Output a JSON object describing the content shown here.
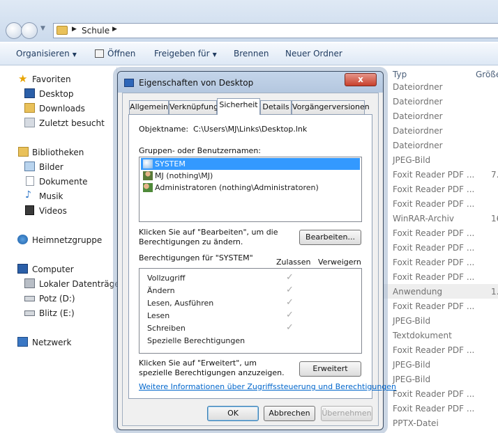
{
  "explorer": {
    "address": {
      "segment": "Schule"
    },
    "toolbar": {
      "organize": "Organisieren",
      "open": "Öffnen",
      "share": "Freigeben für",
      "burn": "Brennen",
      "new_folder": "Neuer Ordner"
    },
    "nav": {
      "favorites": "Favoriten",
      "desktop": "Desktop",
      "downloads": "Downloads",
      "recent": "Zuletzt besucht",
      "libraries": "Bibliotheken",
      "pictures": "Bilder",
      "documents": "Dokumente",
      "music": "Musik",
      "videos": "Videos",
      "homegroup": "Heimnetzgruppe",
      "computer": "Computer",
      "local_disk": "Lokaler Datenträger",
      "potz": "Potz (D:)",
      "blitz": "Blitz (E:)",
      "network": "Netzwerk"
    },
    "columns": {
      "type": "Typ",
      "size": "Größe"
    },
    "files": [
      {
        "type": "Dateiordner",
        "size": ""
      },
      {
        "type": "Dateiordner",
        "size": ""
      },
      {
        "type": "Dateiordner",
        "size": ""
      },
      {
        "type": "Dateiordner",
        "size": ""
      },
      {
        "type": "Dateiordner",
        "size": ""
      },
      {
        "type": "JPEG-Bild",
        "size": ""
      },
      {
        "type": "Foxit Reader PDF ...",
        "size": "7."
      },
      {
        "type": "Foxit Reader PDF ...",
        "size": ""
      },
      {
        "type": "Foxit Reader PDF ...",
        "size": ""
      },
      {
        "type": "WinRAR-Archiv",
        "size": "16."
      },
      {
        "type": "Foxit Reader PDF ...",
        "size": ""
      },
      {
        "type": "Foxit Reader PDF ...",
        "size": ""
      },
      {
        "type": "Foxit Reader PDF ...",
        "size": ""
      },
      {
        "type": "Foxit Reader PDF ...",
        "size": ""
      },
      {
        "type": "Anwendung",
        "size": "1."
      },
      {
        "type": "Foxit Reader PDF ...",
        "size": ""
      },
      {
        "type": "JPEG-Bild",
        "size": ""
      },
      {
        "type": "Textdokument",
        "size": ""
      },
      {
        "type": "Foxit Reader PDF ...",
        "size": ""
      },
      {
        "type": "JPEG-Bild",
        "size": ""
      },
      {
        "type": "JPEG-Bild",
        "size": ""
      },
      {
        "type": "Foxit Reader PDF ...",
        "size": ""
      },
      {
        "type": "Foxit Reader PDF ...",
        "size": ""
      },
      {
        "type": "PPTX-Datei",
        "size": ""
      }
    ]
  },
  "dialog": {
    "title": "Eigenschaften von Desktop",
    "close": "x",
    "tabs": [
      "Allgemein",
      "Verknüpfung",
      "Sicherheit",
      "Details",
      "Vorgängerversionen"
    ],
    "object_label": "Objektname:",
    "object_value": "C:\\Users\\MJ\\Links\\Desktop.lnk",
    "groups_label": "Gruppen- oder Benutzernamen:",
    "users": [
      "SYSTEM",
      "MJ (nothing\\MJ)",
      "Administratoren (nothing\\Administratoren)"
    ],
    "edit_hint": "Klicken Sie auf \"Bearbeiten\", um die Berechtigungen zu ändern.",
    "edit_button": "Bearbeiten...",
    "perm_label": "Berechtigungen für \"SYSTEM\"",
    "allow_col": "Zulassen",
    "deny_col": "Verweigern",
    "permissions": [
      {
        "name": "Vollzugriff",
        "allow": "✓"
      },
      {
        "name": "Ändern",
        "allow": "✓"
      },
      {
        "name": "Lesen, Ausführen",
        "allow": "✓"
      },
      {
        "name": "Lesen",
        "allow": "✓"
      },
      {
        "name": "Schreiben",
        "allow": "✓"
      },
      {
        "name": "Spezielle Berechtigungen",
        "allow": ""
      }
    ],
    "advanced_hint": "Klicken Sie auf \"Erweitert\", um spezielle Berechtigungen anzuzeigen.",
    "advanced_button": "Erweitert",
    "more_info": "Weitere Informationen über Zugriffssteuerung und Berechtigungen",
    "ok": "OK",
    "cancel": "Abbrechen",
    "apply": "Übernehmen"
  }
}
